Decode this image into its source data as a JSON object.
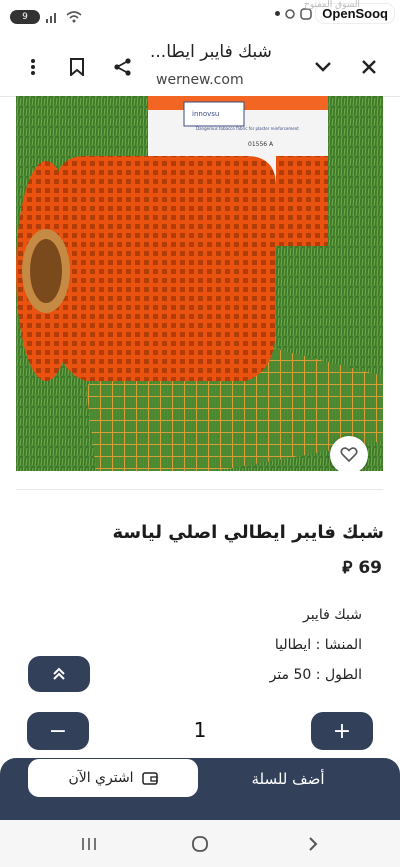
{
  "status_bar": {
    "battery": "9",
    "brand": "OpenSooq",
    "brand_sub": "السوق المفتوح",
    "icons": [
      "wifi-icon",
      "signal-icon"
    ]
  },
  "browser": {
    "title": "شبك فايبر ايطا...",
    "url": "wernew.com",
    "icons": [
      "more-vert-icon",
      "bookmark-icon",
      "share-icon",
      "chevron-down-icon",
      "close-icon"
    ]
  },
  "product": {
    "image_label_brand": "innovsu",
    "image_label_code": "01556 A",
    "image_label_line": "Dangerous tobacco fabric for plaster reinforcement",
    "title": "شبك فايبر ايطالي اصلي لياسة",
    "price": "69",
    "currency_symbol": "⃁",
    "description": [
      "شبك فايبر",
      "المنشا : ايطاليا",
      "الطول : 50 متر"
    ]
  },
  "quantity": {
    "value": "1",
    "minus": "−",
    "plus": "+"
  },
  "actions": {
    "buy_now": "اشتري الآن",
    "add_to_cart": "أضف للسلة"
  },
  "colors": {
    "accent": "#33405a",
    "mesh_orange": "#f26522"
  }
}
